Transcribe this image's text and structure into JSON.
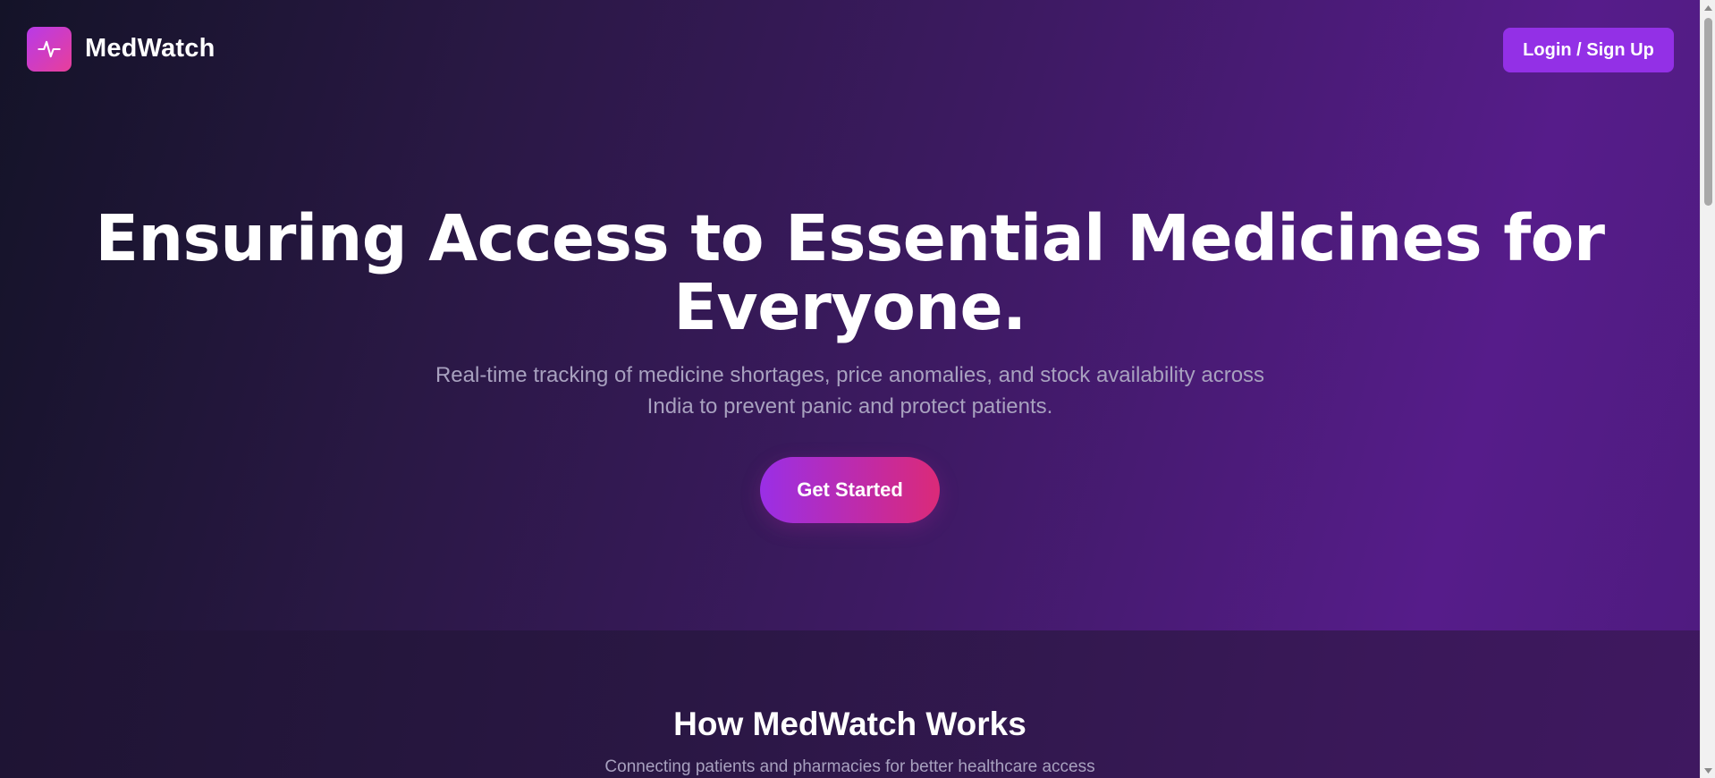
{
  "navbar": {
    "brand_name": "MedWatch",
    "logo_icon": "heartbeat-pulse-icon",
    "login_label": "Login / Sign Up"
  },
  "hero": {
    "title_line1": "Ensuring Access to Essential Medicines for",
    "title_line2": "Everyone.",
    "subtitle": "Real-time tracking of medicine shortages, price anomalies, and stock availability across India to prevent panic and protect patients.",
    "cta_label": "Get Started"
  },
  "how_it_works": {
    "title": "How MedWatch Works",
    "subtitle": "Connecting patients and pharmacies for better healthcare access"
  },
  "colors": {
    "accent_purple": "#9330e6",
    "logo_gradient_start": "#b83ae8",
    "logo_gradient_end": "#e83f9a",
    "cta_gradient_start": "#9a2fe6",
    "cta_gradient_end": "#db2a78",
    "muted_text": "#a8a1bf"
  }
}
